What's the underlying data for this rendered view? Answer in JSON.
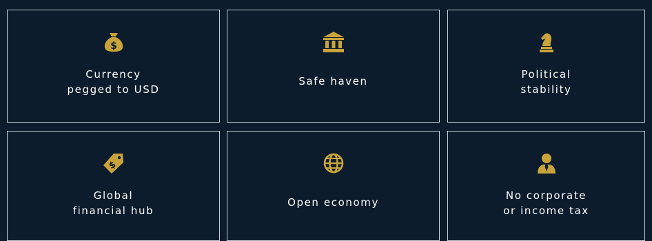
{
  "accent_color": "#c9a43b",
  "background_color": "#0c1c2c",
  "cards": [
    {
      "icon": "money-bag-icon",
      "lines": [
        "Currency",
        "pegged to USD"
      ]
    },
    {
      "icon": "bank-building-icon",
      "lines": [
        "Safe haven"
      ]
    },
    {
      "icon": "chess-knight-icon",
      "lines": [
        "Political",
        "stability"
      ]
    },
    {
      "icon": "price-tag-dollar-icon",
      "lines": [
        "Global",
        "financial hub"
      ]
    },
    {
      "icon": "globe-icon",
      "lines": [
        "Open economy"
      ]
    },
    {
      "icon": "user-tie-icon",
      "lines": [
        "No corporate",
        "or income tax"
      ]
    }
  ]
}
